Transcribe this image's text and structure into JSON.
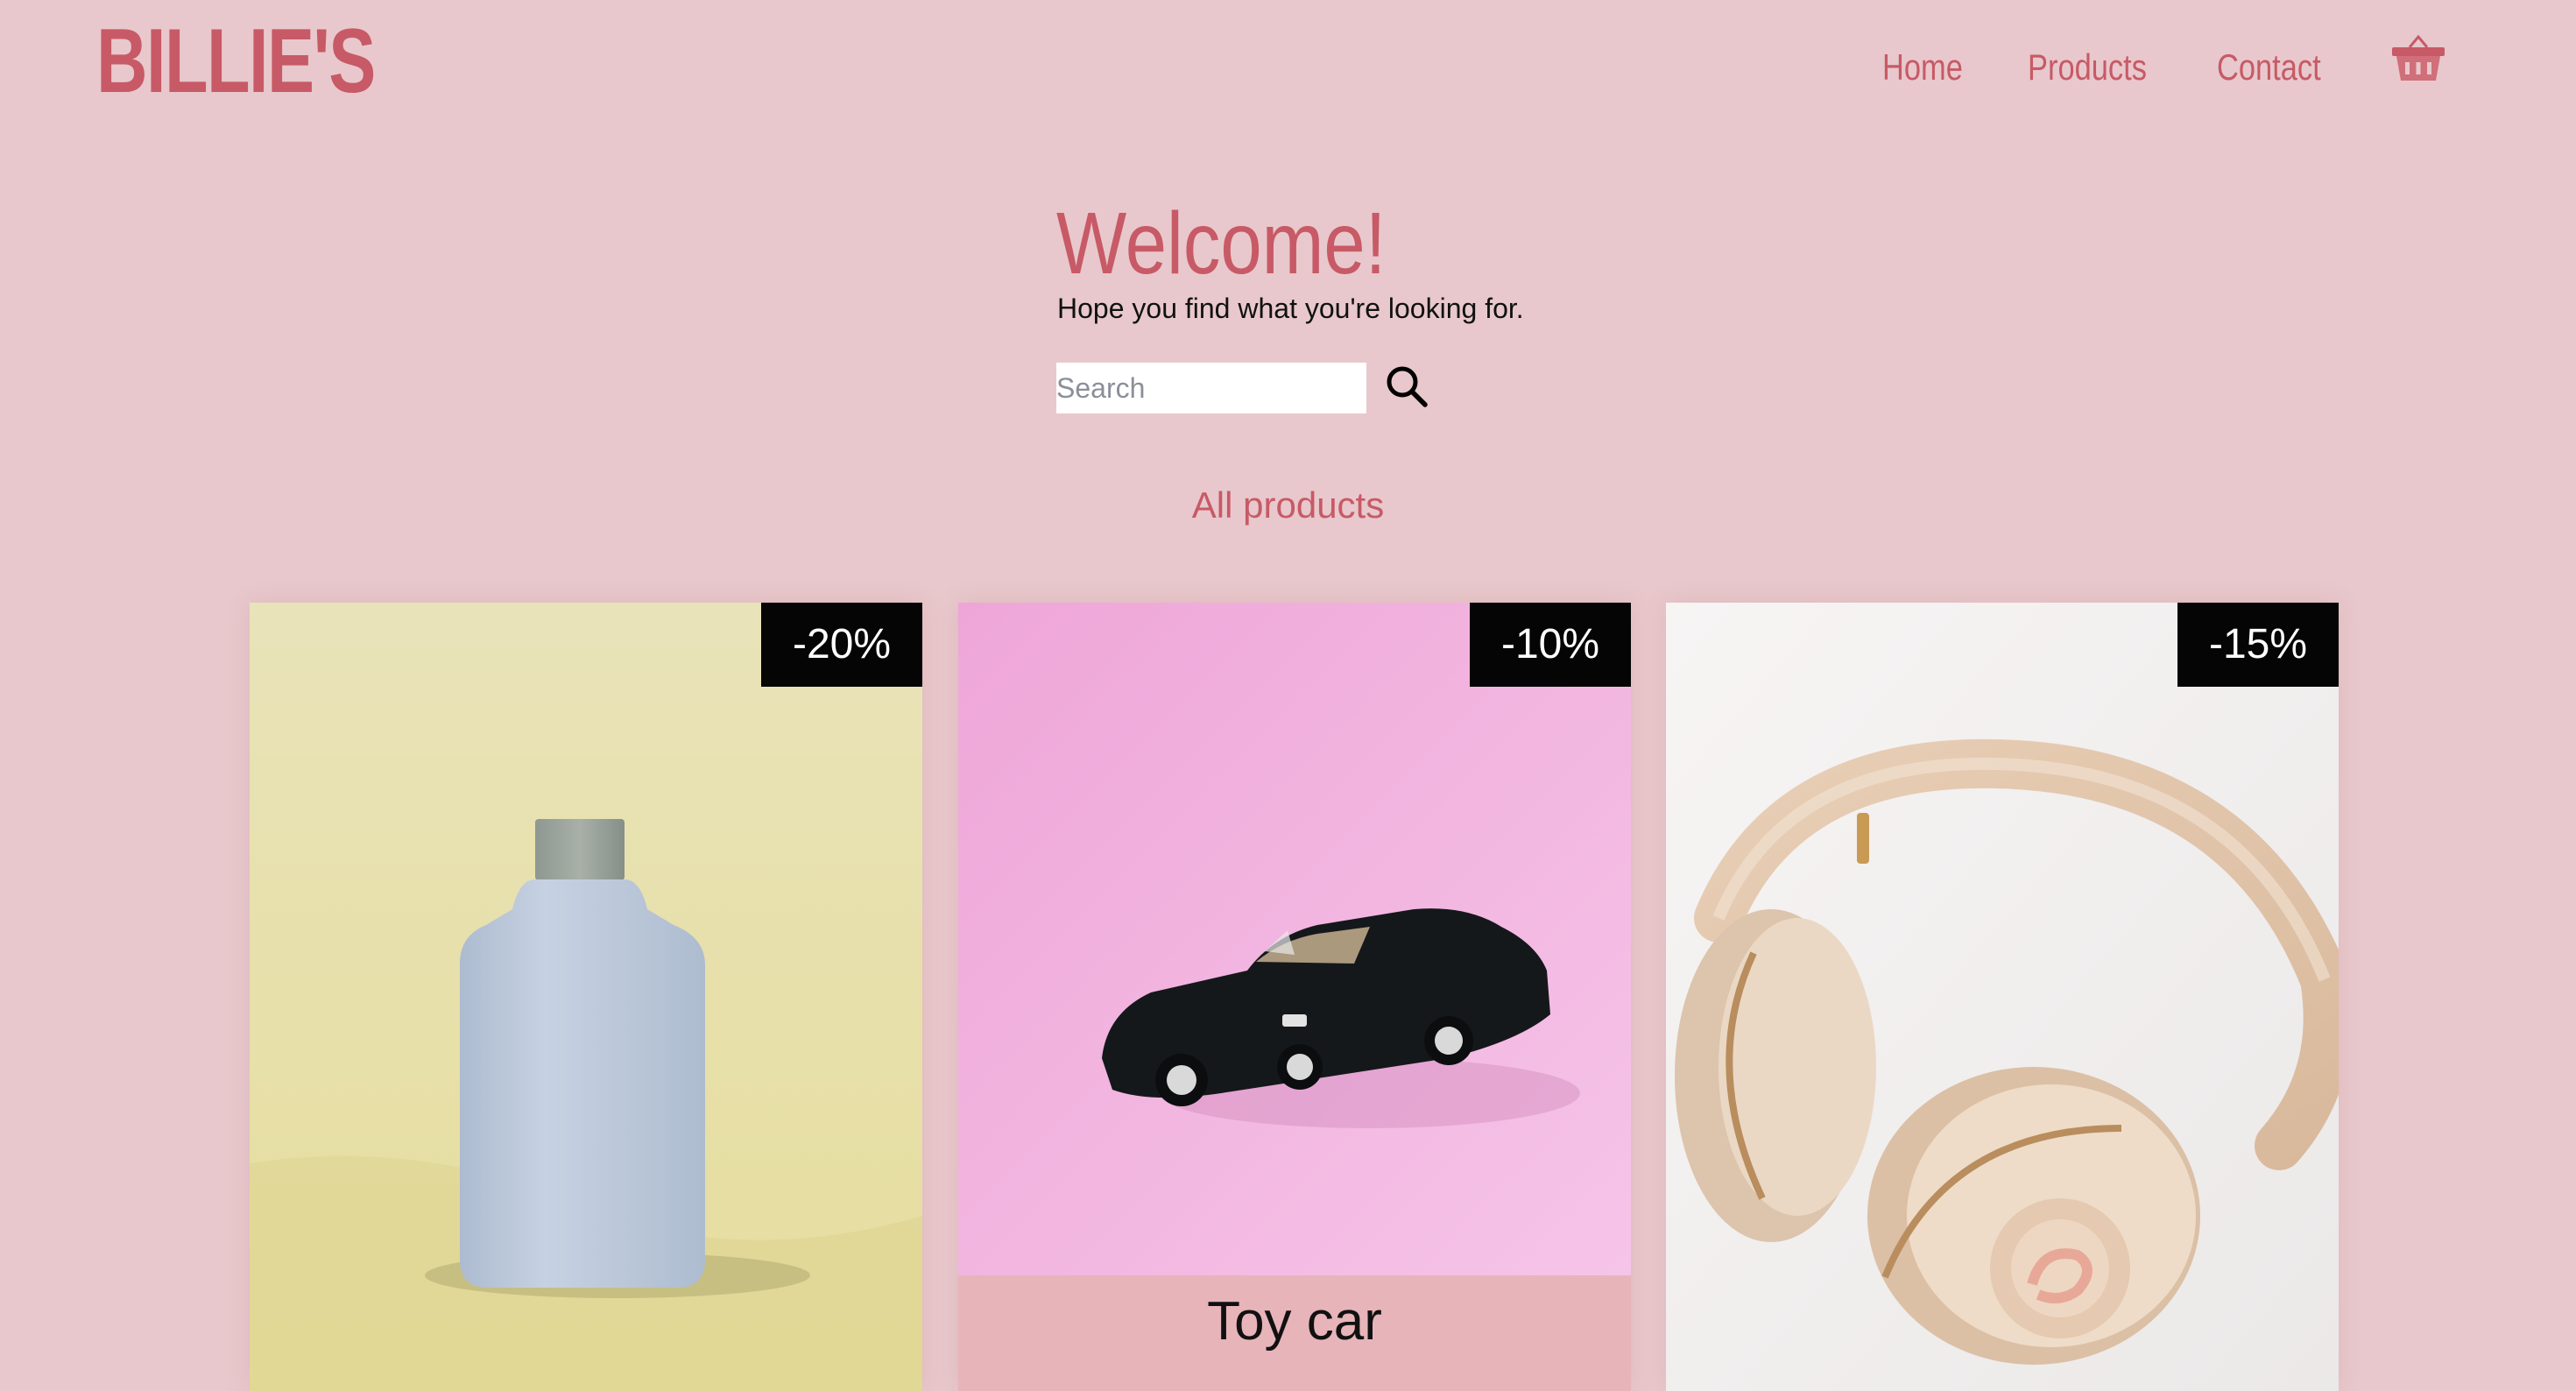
{
  "brand": {
    "logo_text": "BILLIE'S",
    "accent_color": "#c75a66",
    "background_color": "#e8c8cc"
  },
  "nav": {
    "items": [
      {
        "label": "Home"
      },
      {
        "label": "Products"
      },
      {
        "label": "Contact"
      }
    ],
    "cart_icon": "basket-icon"
  },
  "hero": {
    "title": "Welcome!",
    "subtitle": "Hope you find what you're looking for."
  },
  "search": {
    "placeholder": "Search",
    "value": "",
    "icon": "search-icon"
  },
  "section": {
    "label": "All products"
  },
  "products": [
    {
      "badge": "-20%",
      "name": "",
      "image": "perfume-bottle-photo",
      "image_bg": "#ebe5b9"
    },
    {
      "badge": "-10%",
      "name": "Toy car",
      "image": "toy-car-photo",
      "image_bg": "#f2b4dc"
    },
    {
      "badge": "-15%",
      "name": "",
      "image": "headphones-photo",
      "image_bg": "#f4f2f2"
    }
  ]
}
